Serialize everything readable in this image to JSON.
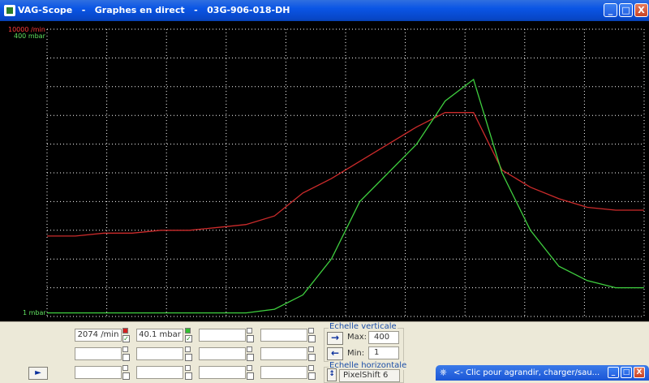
{
  "window": {
    "title": "VAG-Scope   -   Graphes en direct   -   03G-906-018-DH",
    "minimize": "_",
    "maximize": "□",
    "close": "X"
  },
  "plot": {
    "rpm_max_label": "10000 /min",
    "pressure_max_label": "400 mbar",
    "pressure_min_label": "1 mbar",
    "colors": {
      "rpm": "#cc2b2b",
      "pressure": "#3fcf3f",
      "grid": "#ffffff",
      "background": "#000000"
    }
  },
  "chart_data": {
    "type": "line",
    "grid": true,
    "series": [
      {
        "color": "red",
        "y_max": 10000,
        "values": [
          2800,
          2800,
          2900,
          2900,
          3000,
          3000,
          3100,
          3200,
          3500,
          4300,
          4800,
          5400,
          6000,
          6600,
          7100,
          7100,
          5100,
          4500,
          4100,
          3800,
          3700,
          3700
        ]
      },
      {
        "color": "green",
        "y_max": 400,
        "values": [
          5,
          5,
          5,
          5,
          5,
          5,
          5,
          5,
          10,
          30,
          80,
          160,
          200,
          240,
          300,
          330,
          200,
          120,
          70,
          50,
          40,
          40
        ]
      }
    ]
  },
  "channels": [
    {
      "value": "2074 /min",
      "color": "#d32020",
      "checked": true
    },
    {
      "value": "40.1 mbar",
      "color": "#2fbf2f",
      "checked": true
    }
  ],
  "vertical_scale": {
    "label": "Echelle verticale",
    "max_label": "Max:",
    "max_value": "400",
    "min_label": "Min:",
    "min_value": "1"
  },
  "horizontal_scale": {
    "label": "Echelle horizontale",
    "value": "PixelShift 6"
  },
  "floating_window": {
    "title": "<- Clic pour agrandir, charger/sau..."
  }
}
